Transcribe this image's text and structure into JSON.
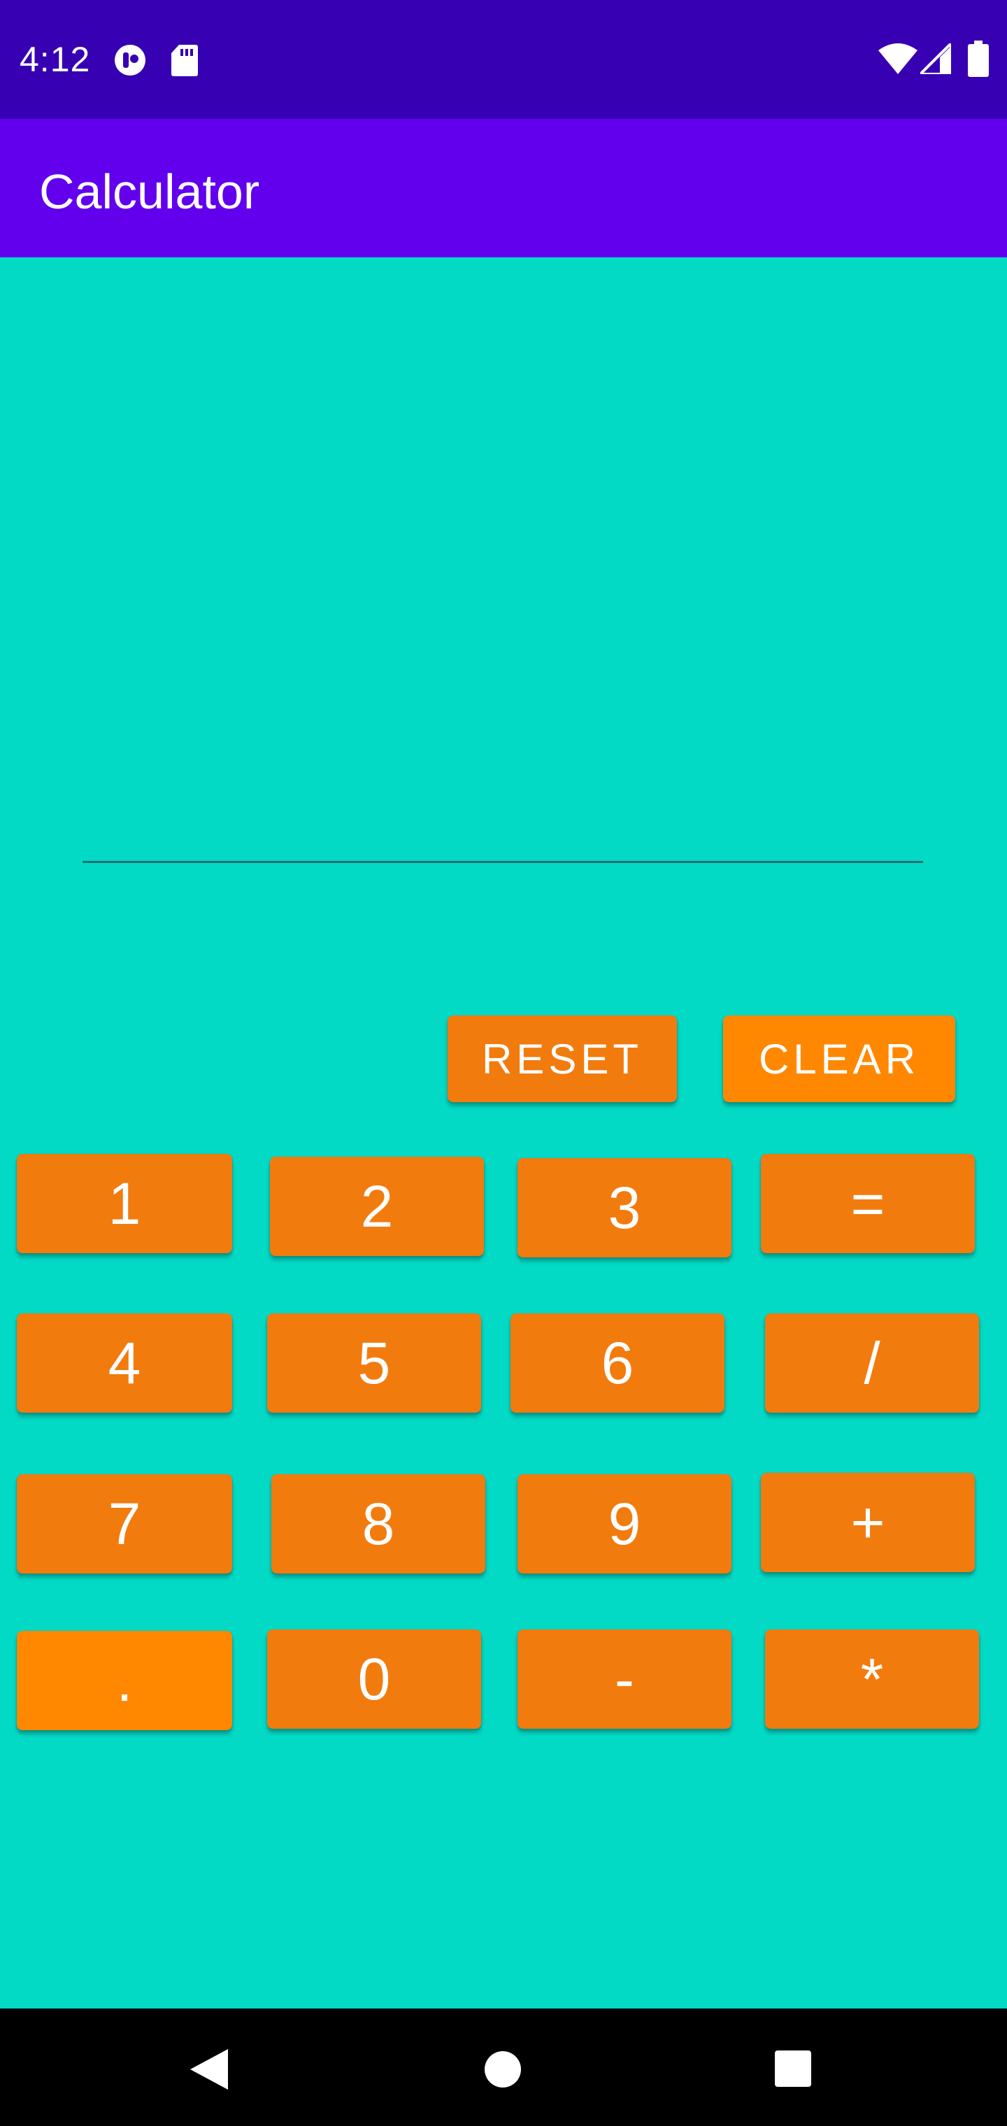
{
  "status_bar": {
    "time": "4:12",
    "icons": [
      "data-saver-icon",
      "sd-card-icon",
      "wifi-icon",
      "cell-signal-icon",
      "battery-icon"
    ]
  },
  "app_bar": {
    "title": "Calculator"
  },
  "display": {
    "value": "",
    "placeholder": ""
  },
  "controls": {
    "reset_label": "RESET",
    "clear_label": "CLEAR"
  },
  "keypad": {
    "k1": "1",
    "k2": "2",
    "k3": "3",
    "equals": "=",
    "k4": "4",
    "k5": "5",
    "k6": "6",
    "divide": "/",
    "k7": "7",
    "k8": "8",
    "k9": "9",
    "plus": "+",
    "dot": ".",
    "k0": "0",
    "minus": "-",
    "multiply": "*"
  },
  "navigation": {
    "icons": [
      "back-icon",
      "home-icon",
      "recents-icon"
    ]
  },
  "colors": {
    "status_bar": "#3700b3",
    "app_bar": "#6200ee",
    "background": "#03dac6",
    "button": "#f27b0e",
    "button_bright": "#ff8800",
    "nav_bar": "#000000"
  }
}
